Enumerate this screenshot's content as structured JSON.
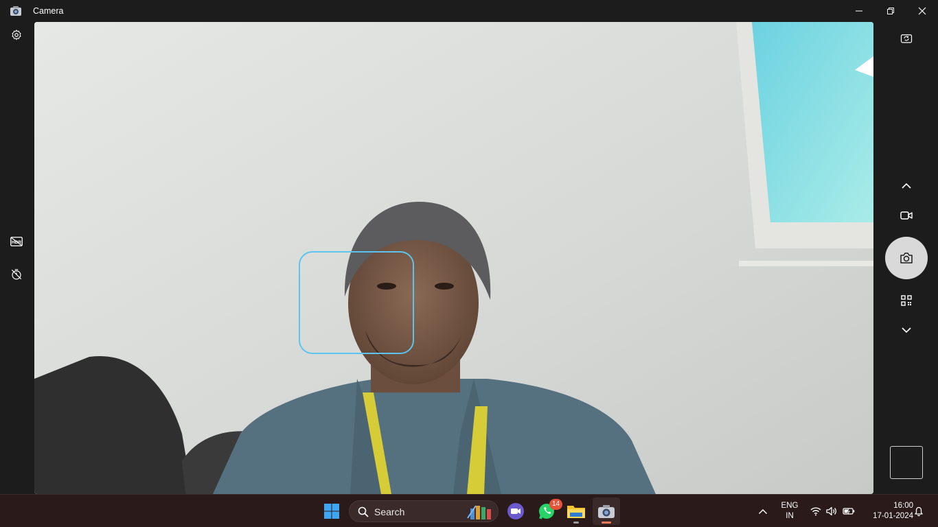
{
  "window": {
    "title": "Camera",
    "icon": "camera-app-icon",
    "controls": [
      "minimize-icon",
      "restore-icon",
      "close-icon"
    ]
  },
  "left_rail": {
    "items": [
      {
        "name": "settings",
        "icon": "gear-icon"
      },
      {
        "name": "hdr",
        "icon": "hdr-off-icon",
        "label": "HDR"
      },
      {
        "name": "timer",
        "icon": "timer-off-icon"
      }
    ]
  },
  "right_rail": {
    "items": [
      {
        "name": "switch-camera",
        "icon": "switch-camera-icon"
      },
      {
        "name": "mode-up",
        "icon": "chevron-up-icon"
      },
      {
        "name": "video-mode",
        "icon": "video-camera-icon"
      },
      {
        "name": "photo-shutter",
        "icon": "camera-icon"
      },
      {
        "name": "scan-mode",
        "icon": "qr-code-icon"
      },
      {
        "name": "mode-down",
        "icon": "chevron-down-icon"
      }
    ]
  },
  "preview": {
    "focus_indicator_color": "#5cc4ee"
  },
  "taskbar": {
    "search_placeholder": "Search",
    "apps": [
      {
        "name": "start",
        "icon": "windows-start-icon"
      },
      {
        "name": "search",
        "icon": "search-icon"
      },
      {
        "name": "meet",
        "icon": "video-meeting-icon"
      },
      {
        "name": "whatsapp",
        "icon": "whatsapp-icon",
        "badge": "14"
      },
      {
        "name": "file-explorer",
        "icon": "folder-icon"
      },
      {
        "name": "camera",
        "icon": "camera-app-icon"
      }
    ],
    "language": {
      "line1": "ENG",
      "line2": "IN"
    },
    "tray": [
      "chevron-up-icon",
      "wifi-icon",
      "volume-icon",
      "battery-icon",
      "notification-bell-icon"
    ],
    "time": "16:00",
    "date": "17-01-2024"
  },
  "colors": {
    "chrome": "#1c1c1c",
    "taskbar": "#2b1a1a",
    "shutter": "#d9d9d9",
    "accent": "#5cc4ee",
    "badge": "#e5533b"
  }
}
